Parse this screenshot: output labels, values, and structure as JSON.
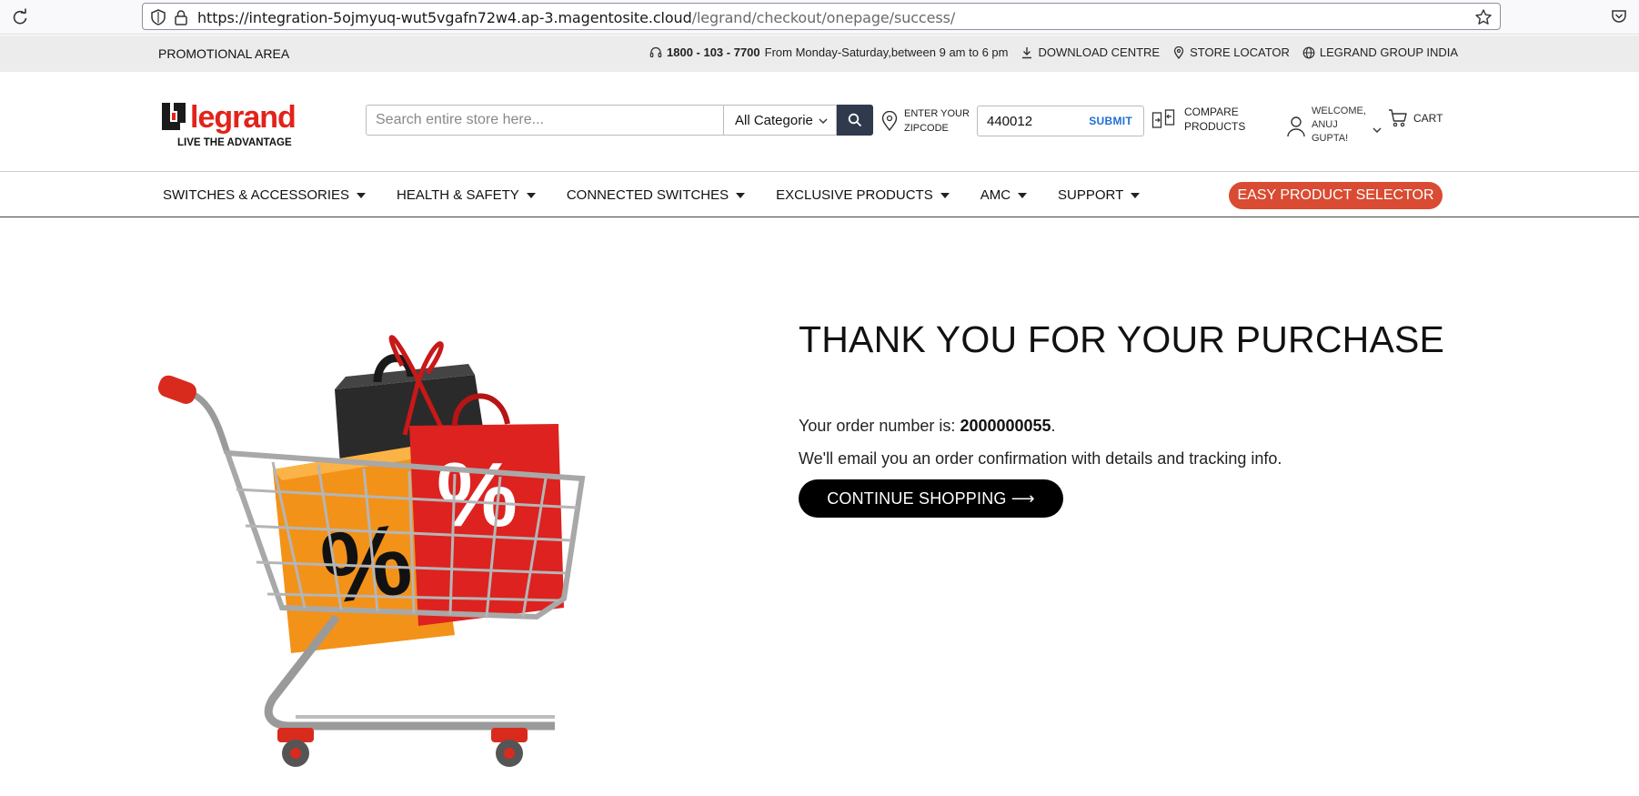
{
  "browser": {
    "url_host": "https://integration-5ojmyuq-wut5vgafn72w4.ap-3.magentosite.cloud",
    "url_path": "/legrand/checkout/onepage/success/"
  },
  "promo": {
    "area_label": "PROMOTIONAL AREA",
    "phone": "1800 - 103 - 7700",
    "hours": "From Monday-Saturday,between 9 am to 6 pm",
    "download": "DOWNLOAD CENTRE",
    "store_locator": "STORE LOCATOR",
    "group": "LEGRAND GROUP INDIA"
  },
  "header": {
    "logo_text": "legrand",
    "logo_tagline": "LIVE THE ADVANTAGE",
    "search_placeholder": "Search entire store here...",
    "category": "All Categorie",
    "zip_label": "ENTER YOUR ZIPCODE",
    "zip_value": "440012",
    "zip_submit": "SUBMIT",
    "compare": "COMPARE PRODUCTS",
    "welcome": "WELCOME, ANUJ GUPTA!",
    "cart": "CART"
  },
  "nav": {
    "items": [
      {
        "label": "SWITCHES & ACCESSORIES"
      },
      {
        "label": "HEALTH & SAFETY"
      },
      {
        "label": "CONNECTED SWITCHES"
      },
      {
        "label": "EXCLUSIVE PRODUCTS"
      },
      {
        "label": "AMC"
      },
      {
        "label": "SUPPORT"
      }
    ],
    "selector": "EASY PRODUCT SELECTOR"
  },
  "success": {
    "title": "THANK YOU FOR YOUR PURCHASE",
    "order_prefix": "Your order number is: ",
    "order_number": "2000000055",
    "order_suffix": ".",
    "email_note": "We'll email you an order confirmation with details and tracking info.",
    "continue": "CONTINUE SHOPPING ⟶"
  },
  "colors": {
    "accent_red": "#d94b32",
    "search_button": "#2f3b4c",
    "continue_button": "#000000"
  }
}
